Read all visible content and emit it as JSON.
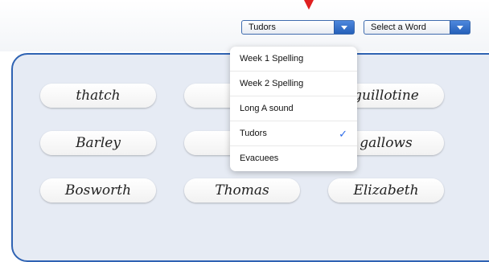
{
  "toolbar": {
    "topic_select": {
      "value": "Tudors"
    },
    "word_select": {
      "placeholder": "Select a Word"
    }
  },
  "topic_menu": {
    "items": [
      {
        "label": "Week 1 Spelling",
        "selected": false
      },
      {
        "label": "Week 2 Spelling",
        "selected": false
      },
      {
        "label": "Long A sound",
        "selected": false
      },
      {
        "label": "Tudors",
        "selected": true,
        "check": "✓"
      },
      {
        "label": "Evacuees",
        "selected": false
      }
    ]
  },
  "words": {
    "row1": [
      "thatch",
      "c",
      "guillotine"
    ],
    "row2": [
      "Barley",
      "f",
      "gallows"
    ],
    "row3": [
      "Bosworth",
      "Thomas",
      "Elizabeth"
    ]
  },
  "colors": {
    "accent": "#2f63b3",
    "board_bg": "#e6ebf4",
    "pointer": "#e02020",
    "check": "#2a6ae8"
  }
}
